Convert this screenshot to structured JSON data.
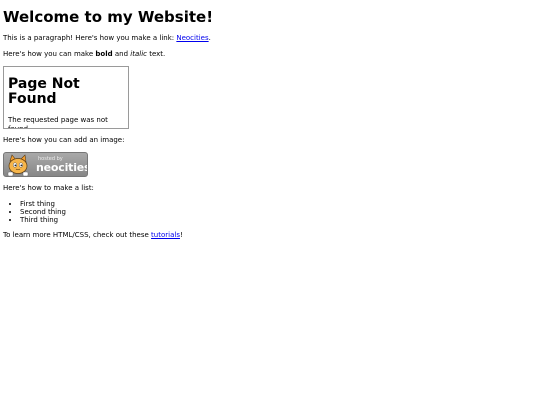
{
  "heading": "Welcome to my Website!",
  "para1": {
    "before": "This is a paragraph! Here's how you make a link: ",
    "link": "Neocities",
    "after": "."
  },
  "para2": {
    "before": "Here's how you can make ",
    "bold": "bold",
    "middle": " and ",
    "italic": "italic",
    "after": " text."
  },
  "frame": {
    "title": "Page Not Found",
    "text": "The requested page was not found."
  },
  "image_intro": "Here's how you can add an image:",
  "badge": {
    "small_text": "hosted by",
    "big_text": "neocities",
    "icon": "neocities-cat-icon"
  },
  "list_intro": "Here's how to make a list:",
  "list": [
    "First thing",
    "Second thing",
    "Third thing"
  ],
  "outro": {
    "before": "To learn more HTML/CSS, check out these ",
    "link": "tutorials",
    "after": "!"
  },
  "colors": {
    "link": "#0000ee",
    "frame_border": "#9a9a9a",
    "badge_bg": "#9a9a9a"
  }
}
